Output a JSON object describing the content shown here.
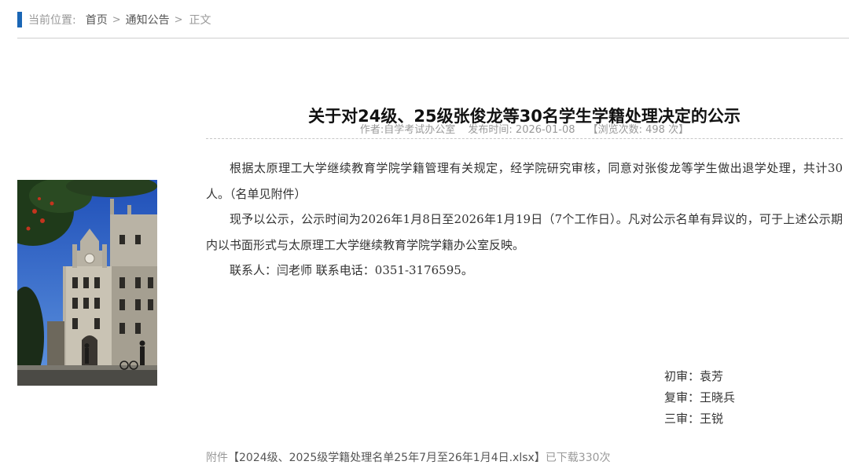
{
  "breadcrumb": {
    "label": "当前位置:",
    "items": [
      "首页",
      "通知公告"
    ],
    "separator": ">",
    "current": "正文"
  },
  "article": {
    "title": "关于对24级、25级张俊龙等30名学生学籍处理决定的公示",
    "author": "作者:自学考试办公室",
    "publish_time": "发布时间: 2026-01-08",
    "views": "【浏览次数: 498 次】",
    "paragraphs": [
      "根据太原理工大学继续教育学院学籍管理有关规定，经学院研究审核，同意对张俊龙等学生做出退学处理，共计30人。（名单见附件）",
      "现予以公示，公示时间为2026年1月8日至2026年1月19日（7个工作日）。凡对公示名单有异议的，可于上述公示期内以书面形式与太原理工大学继续教育学院学籍办公室反映。",
      "联系人：闫老师 联系电话：0351-3176595。"
    ],
    "reviewers": [
      "初审：袁芳",
      "复审：王晓兵",
      "三审：王锐"
    ]
  },
  "attachment": {
    "prefix": "附件",
    "name": "【2024级、2025级学籍处理名单25年7月至26年1月4日.xlsx】",
    "downloads": "已下载330次"
  },
  "colors": {
    "accent": "#1a66b5",
    "rule": "#cfcfcf",
    "muted_text": "#999999"
  }
}
